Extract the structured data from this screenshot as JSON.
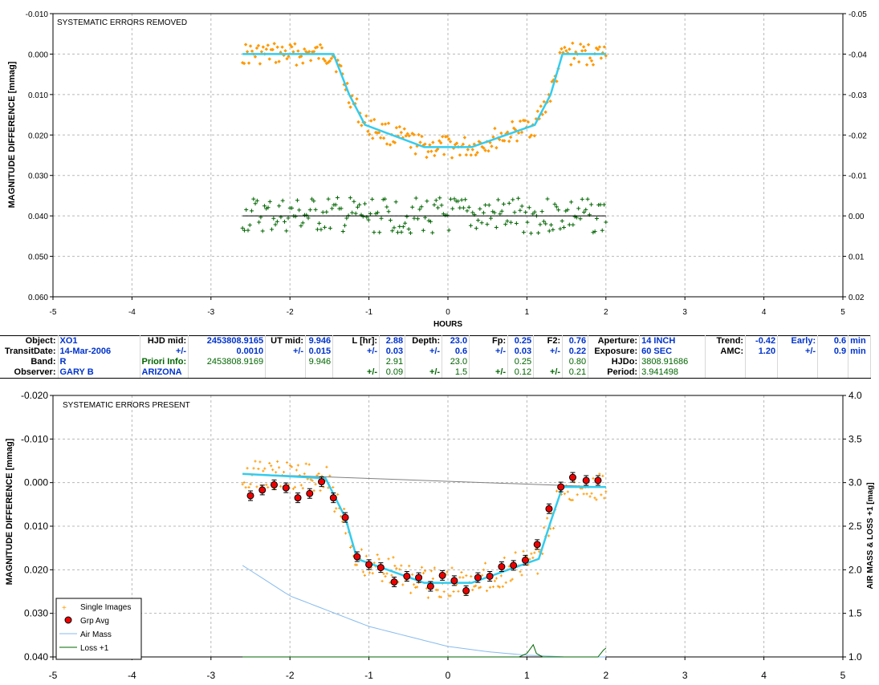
{
  "chart_data": [
    {
      "type": "scatter",
      "title": "SYSTEMATIC ERRORS REMOVED",
      "xlabel": "HOURS",
      "ylabel": "MAGNITUDE DIFFERENCE [mmag]",
      "xlim": [
        -5,
        5
      ],
      "ylim": [
        -0.01,
        0.06
      ],
      "ylim_right": [
        -0.05,
        0.02
      ],
      "grid": true,
      "x_ticks": [
        "-5",
        "-4",
        "-3",
        "-2",
        "-1",
        "0",
        "1",
        "2",
        "3",
        "4",
        "5"
      ],
      "y_ticks": [
        "-0.010",
        "0.000",
        "0.010",
        "0.020",
        "0.030",
        "0.040",
        "0.050",
        "0.060"
      ],
      "y_right_ticks": [
        "-0.05",
        "-0.04",
        "-0.03",
        "-0.02",
        "-0.01",
        "0.00",
        "0.01",
        "0.02"
      ],
      "model_line": {
        "color": "#33ccee",
        "x": [
          -2.6,
          -1.45,
          -1.25,
          -1.05,
          -0.3,
          0.3,
          1.1,
          1.3,
          1.45,
          2.0
        ],
        "y": [
          0.0,
          0.0,
          0.01,
          0.0175,
          0.023,
          0.023,
          0.0175,
          0.01,
          0.0,
          0.0
        ]
      },
      "residual_line": {
        "color": "#000000",
        "x": [
          -2.6,
          2.0
        ],
        "y": [
          0.04,
          0.04
        ]
      },
      "series": [
        {
          "color": "#ff9900",
          "marker": "diamond",
          "description_x_range": [
            -2.6,
            2.0
          ],
          "values_follow_model": true
        },
        {
          "color": "#006600",
          "marker": "plus",
          "description_x_range": [
            -2.6,
            2.0
          ],
          "center": 0.04,
          "spread": 0.006
        }
      ]
    },
    {
      "type": "scatter",
      "title": "SYSTEMATIC ERRORS PRESENT",
      "xlabel": "",
      "ylabel": "MAGNITUDE DIFFERENCE [mmag]",
      "ylabel_right": "AIR MASS & LOSS +1 [mag]",
      "xlim": [
        -5,
        5
      ],
      "ylim": [
        -0.02,
        0.04
      ],
      "ylim_right": [
        1.0,
        4.0
      ],
      "grid": true,
      "x_ticks": [
        "-5",
        "-4",
        "-3",
        "-2",
        "-1",
        "0",
        "1",
        "2",
        "3",
        "4",
        "5"
      ],
      "y_ticks": [
        "-0.020",
        "-0.010",
        "0.000",
        "0.010",
        "0.020",
        "0.030",
        "0.040"
      ],
      "y_right_ticks": [
        "1.0",
        "1.5",
        "2.0",
        "2.5",
        "3.0",
        "3.5",
        "4.0"
      ],
      "legend": {
        "position": "bottom-left",
        "entries": [
          "Single Images",
          "Grp Avg",
          "Air Mass",
          "Loss +1"
        ]
      },
      "model_line": {
        "color": "#33ccee",
        "x": [
          -2.6,
          -1.55,
          -1.3,
          -1.15,
          -0.3,
          0.3,
          1.15,
          1.3,
          1.45,
          2.0
        ],
        "y": [
          -0.002,
          -0.001,
          0.008,
          0.0175,
          0.023,
          0.023,
          0.0175,
          0.009,
          0.001,
          0.001
        ]
      },
      "trend_line": {
        "color": "#808080",
        "x": [
          -2.6,
          2.0
        ],
        "y": [
          -0.002,
          0.001
        ]
      },
      "grp_avg": {
        "x": [
          -2.5,
          -2.35,
          -2.2,
          -2.05,
          -1.9,
          -1.75,
          -1.6,
          -1.45,
          -1.3,
          -1.15,
          -1.0,
          -0.85,
          -0.68,
          -0.52,
          -0.37,
          -0.22,
          -0.07,
          0.08,
          0.23,
          0.38,
          0.53,
          0.68,
          0.83,
          0.98,
          1.13,
          1.28,
          1.43,
          1.58,
          1.75,
          1.9
        ],
        "y": [
          0.003,
          0.0017,
          0.0005,
          0.0012,
          0.0035,
          0.0025,
          -0.0002,
          0.0035,
          0.008,
          0.017,
          0.0188,
          0.0195,
          0.0228,
          0.0215,
          0.0218,
          0.0238,
          0.0213,
          0.0225,
          0.0248,
          0.0218,
          0.0215,
          0.0193,
          0.019,
          0.0178,
          0.0142,
          0.006,
          0.001,
          -0.0012,
          -0.0005,
          -0.0005
        ]
      },
      "air_mass": {
        "x": [
          -2.6,
          -2.0,
          -1.0,
          0.0,
          0.5,
          1.0,
          1.5,
          2.0
        ],
        "y": [
          2.05,
          1.7,
          1.35,
          1.12,
          1.06,
          1.02,
          1.0,
          1.0
        ]
      },
      "loss_plus_1": {
        "x": [
          -2.6,
          0.9,
          1.0,
          1.08,
          1.12,
          1.2,
          1.9,
          1.97,
          2.0
        ],
        "y": [
          1.0,
          1.0,
          1.04,
          1.14,
          1.04,
          1.0,
          1.0,
          1.08,
          1.1
        ]
      }
    }
  ],
  "info": {
    "rows": [
      [
        {
          "t": "Object:",
          "c": "lbl"
        },
        {
          "t": "XO1",
          "c": "bv"
        },
        {
          "t": "HJD mid:",
          "c": "lbl"
        },
        {
          "t": "2453808.9165",
          "c": "bv r"
        },
        {
          "t": "UT mid:",
          "c": "lbl"
        },
        {
          "t": "9.946",
          "c": "bv r"
        },
        {
          "t": "L [hr]:",
          "c": "lbl"
        },
        {
          "t": "2.88",
          "c": "bv r"
        },
        {
          "t": "Depth:",
          "c": "lbl"
        },
        {
          "t": "23.0",
          "c": "bv r"
        },
        {
          "t": "Fp:",
          "c": "lbl"
        },
        {
          "t": "0.25",
          "c": "bv r"
        },
        {
          "t": "F2:",
          "c": "lbl"
        },
        {
          "t": "0.76",
          "c": "bv r"
        },
        {
          "t": "Aperture:",
          "c": "lbl"
        },
        {
          "t": "14 INCH",
          "c": "bv"
        },
        {
          "t": "Trend:",
          "c": "lbl"
        },
        {
          "t": "-0.42",
          "c": "bv r"
        },
        {
          "t": "Early:",
          "c": "bv r"
        },
        {
          "t": "0.6",
          "c": "bv r"
        },
        {
          "t": "min",
          "c": "bv"
        }
      ],
      [
        {
          "t": "TransitDate:",
          "c": "lbl"
        },
        {
          "t": "14-Mar-2006",
          "c": "bv"
        },
        {
          "t": "+/-",
          "c": "bv r"
        },
        {
          "t": "0.0010",
          "c": "bv r"
        },
        {
          "t": "+/-",
          "c": "bv r"
        },
        {
          "t": "0.015",
          "c": "bv r"
        },
        {
          "t": "+/-",
          "c": "bv r"
        },
        {
          "t": "0.03",
          "c": "bv r"
        },
        {
          "t": "+/-",
          "c": "bv r"
        },
        {
          "t": "0.6",
          "c": "bv r"
        },
        {
          "t": "+/-",
          "c": "bv r"
        },
        {
          "t": "0.03",
          "c": "bv r"
        },
        {
          "t": "+/-",
          "c": "bv r"
        },
        {
          "t": "0.22",
          "c": "bv r"
        },
        {
          "t": "Exposure:",
          "c": "lbl"
        },
        {
          "t": "60 SEC",
          "c": "bv"
        },
        {
          "t": "AMC:",
          "c": "lbl"
        },
        {
          "t": "1.20",
          "c": "bv r"
        },
        {
          "t": "+/-",
          "c": "bv r"
        },
        {
          "t": "0.9",
          "c": "bv r"
        },
        {
          "t": "min",
          "c": "bv"
        }
      ],
      [
        {
          "t": "Band:",
          "c": "lbl"
        },
        {
          "t": "R",
          "c": "bv"
        },
        {
          "t": "Priori Info:",
          "c": "gl"
        },
        {
          "t": "2453808.9169",
          "c": "gv r"
        },
        {
          "t": "",
          "c": ""
        },
        {
          "t": "9.946",
          "c": "gv r"
        },
        {
          "t": "",
          "c": ""
        },
        {
          "t": "2.91",
          "c": "gv r"
        },
        {
          "t": "",
          "c": ""
        },
        {
          "t": "23.0",
          "c": "gv r"
        },
        {
          "t": "",
          "c": ""
        },
        {
          "t": "0.25",
          "c": "gv r"
        },
        {
          "t": "",
          "c": ""
        },
        {
          "t": "0.80",
          "c": "gv r"
        },
        {
          "t": "HJDo:",
          "c": "lbl"
        },
        {
          "t": "3808.91686",
          "c": "gv"
        },
        {
          "t": "",
          "c": ""
        },
        {
          "t": "",
          "c": ""
        },
        {
          "t": "",
          "c": ""
        },
        {
          "t": "",
          "c": ""
        },
        {
          "t": "",
          "c": ""
        }
      ],
      [
        {
          "t": "Observer:",
          "c": "lbl"
        },
        {
          "t": "GARY B",
          "c": "bv"
        },
        {
          "t": "ARIZONA",
          "c": "bv"
        },
        {
          "t": "",
          "c": ""
        },
        {
          "t": "",
          "c": ""
        },
        {
          "t": "",
          "c": ""
        },
        {
          "t": "+/-",
          "c": "gl r"
        },
        {
          "t": "0.09",
          "c": "gv r"
        },
        {
          "t": "+/-",
          "c": "gl r"
        },
        {
          "t": "1.5",
          "c": "gv r"
        },
        {
          "t": "+/-",
          "c": "gl r"
        },
        {
          "t": "0.12",
          "c": "gv r"
        },
        {
          "t": "+/-",
          "c": "gl r"
        },
        {
          "t": "0.21",
          "c": "gv r"
        },
        {
          "t": "Period:",
          "c": "lbl"
        },
        {
          "t": "3.941498",
          "c": "gv"
        },
        {
          "t": "",
          "c": ""
        },
        {
          "t": "",
          "c": ""
        },
        {
          "t": "",
          "c": ""
        },
        {
          "t": "",
          "c": ""
        },
        {
          "t": "",
          "c": ""
        }
      ]
    ]
  }
}
